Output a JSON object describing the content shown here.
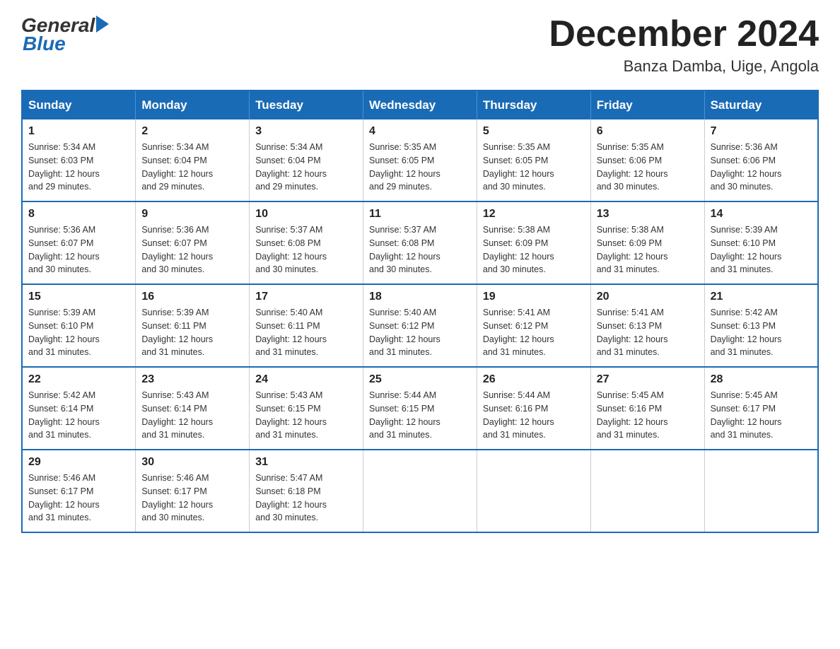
{
  "logo": {
    "general": "General",
    "blue": "Blue"
  },
  "title": "December 2024",
  "location": "Banza Damba, Uige, Angola",
  "days_of_week": [
    "Sunday",
    "Monday",
    "Tuesday",
    "Wednesday",
    "Thursday",
    "Friday",
    "Saturday"
  ],
  "weeks": [
    [
      {
        "day": "1",
        "sunrise": "5:34 AM",
        "sunset": "6:03 PM",
        "daylight": "12 hours and 29 minutes."
      },
      {
        "day": "2",
        "sunrise": "5:34 AM",
        "sunset": "6:04 PM",
        "daylight": "12 hours and 29 minutes."
      },
      {
        "day": "3",
        "sunrise": "5:34 AM",
        "sunset": "6:04 PM",
        "daylight": "12 hours and 29 minutes."
      },
      {
        "day": "4",
        "sunrise": "5:35 AM",
        "sunset": "6:05 PM",
        "daylight": "12 hours and 29 minutes."
      },
      {
        "day": "5",
        "sunrise": "5:35 AM",
        "sunset": "6:05 PM",
        "daylight": "12 hours and 30 minutes."
      },
      {
        "day": "6",
        "sunrise": "5:35 AM",
        "sunset": "6:06 PM",
        "daylight": "12 hours and 30 minutes."
      },
      {
        "day": "7",
        "sunrise": "5:36 AM",
        "sunset": "6:06 PM",
        "daylight": "12 hours and 30 minutes."
      }
    ],
    [
      {
        "day": "8",
        "sunrise": "5:36 AM",
        "sunset": "6:07 PM",
        "daylight": "12 hours and 30 minutes."
      },
      {
        "day": "9",
        "sunrise": "5:36 AM",
        "sunset": "6:07 PM",
        "daylight": "12 hours and 30 minutes."
      },
      {
        "day": "10",
        "sunrise": "5:37 AM",
        "sunset": "6:08 PM",
        "daylight": "12 hours and 30 minutes."
      },
      {
        "day": "11",
        "sunrise": "5:37 AM",
        "sunset": "6:08 PM",
        "daylight": "12 hours and 30 minutes."
      },
      {
        "day": "12",
        "sunrise": "5:38 AM",
        "sunset": "6:09 PM",
        "daylight": "12 hours and 30 minutes."
      },
      {
        "day": "13",
        "sunrise": "5:38 AM",
        "sunset": "6:09 PM",
        "daylight": "12 hours and 31 minutes."
      },
      {
        "day": "14",
        "sunrise": "5:39 AM",
        "sunset": "6:10 PM",
        "daylight": "12 hours and 31 minutes."
      }
    ],
    [
      {
        "day": "15",
        "sunrise": "5:39 AM",
        "sunset": "6:10 PM",
        "daylight": "12 hours and 31 minutes."
      },
      {
        "day": "16",
        "sunrise": "5:39 AM",
        "sunset": "6:11 PM",
        "daylight": "12 hours and 31 minutes."
      },
      {
        "day": "17",
        "sunrise": "5:40 AM",
        "sunset": "6:11 PM",
        "daylight": "12 hours and 31 minutes."
      },
      {
        "day": "18",
        "sunrise": "5:40 AM",
        "sunset": "6:12 PM",
        "daylight": "12 hours and 31 minutes."
      },
      {
        "day": "19",
        "sunrise": "5:41 AM",
        "sunset": "6:12 PM",
        "daylight": "12 hours and 31 minutes."
      },
      {
        "day": "20",
        "sunrise": "5:41 AM",
        "sunset": "6:13 PM",
        "daylight": "12 hours and 31 minutes."
      },
      {
        "day": "21",
        "sunrise": "5:42 AM",
        "sunset": "6:13 PM",
        "daylight": "12 hours and 31 minutes."
      }
    ],
    [
      {
        "day": "22",
        "sunrise": "5:42 AM",
        "sunset": "6:14 PM",
        "daylight": "12 hours and 31 minutes."
      },
      {
        "day": "23",
        "sunrise": "5:43 AM",
        "sunset": "6:14 PM",
        "daylight": "12 hours and 31 minutes."
      },
      {
        "day": "24",
        "sunrise": "5:43 AM",
        "sunset": "6:15 PM",
        "daylight": "12 hours and 31 minutes."
      },
      {
        "day": "25",
        "sunrise": "5:44 AM",
        "sunset": "6:15 PM",
        "daylight": "12 hours and 31 minutes."
      },
      {
        "day": "26",
        "sunrise": "5:44 AM",
        "sunset": "6:16 PM",
        "daylight": "12 hours and 31 minutes."
      },
      {
        "day": "27",
        "sunrise": "5:45 AM",
        "sunset": "6:16 PM",
        "daylight": "12 hours and 31 minutes."
      },
      {
        "day": "28",
        "sunrise": "5:45 AM",
        "sunset": "6:17 PM",
        "daylight": "12 hours and 31 minutes."
      }
    ],
    [
      {
        "day": "29",
        "sunrise": "5:46 AM",
        "sunset": "6:17 PM",
        "daylight": "12 hours and 31 minutes."
      },
      {
        "day": "30",
        "sunrise": "5:46 AM",
        "sunset": "6:17 PM",
        "daylight": "12 hours and 30 minutes."
      },
      {
        "day": "31",
        "sunrise": "5:47 AM",
        "sunset": "6:18 PM",
        "daylight": "12 hours and 30 minutes."
      },
      null,
      null,
      null,
      null
    ]
  ],
  "labels": {
    "sunrise": "Sunrise:",
    "sunset": "Sunset:",
    "daylight": "Daylight:"
  }
}
